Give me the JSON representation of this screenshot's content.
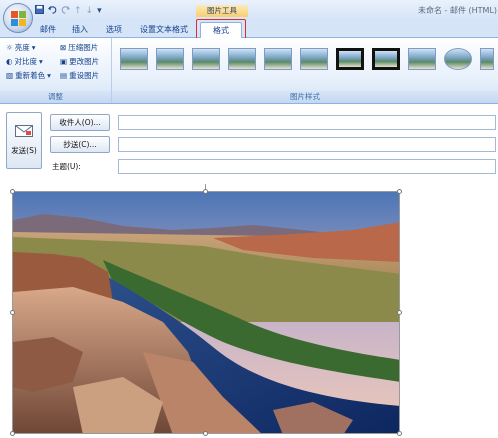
{
  "window": {
    "context_tool_title": "图片工具",
    "doc_title": "未命名 - 邮件 (HTML)"
  },
  "quick_access": {
    "save_icon": "save-icon",
    "undo_icon": "undo-icon",
    "redo_icon": "redo-icon",
    "customize_label": "▾"
  },
  "tabs": [
    {
      "label": "邮件"
    },
    {
      "label": "插入"
    },
    {
      "label": "选项"
    },
    {
      "label": "设置文本格式"
    },
    {
      "label": "格式",
      "active": true
    }
  ],
  "ribbon": {
    "adjust": {
      "label": "调整",
      "brightness": "亮度",
      "contrast": "对比度",
      "recolor": "重新着色",
      "compress": "压缩图片",
      "change": "更改图片",
      "reset": "重设图片"
    },
    "styles": {
      "label": "图片样式"
    }
  },
  "form": {
    "send_label": "发送(S)",
    "to_label": "收件人(O)...",
    "cc_label": "抄送(C)...",
    "subject_label": "主题(U):",
    "to_value": "",
    "cc_value": "",
    "subject_value": ""
  },
  "colors": {
    "ribbon_bg": "#d5e4f7",
    "accent": "#15428b",
    "highlight": "#e22a2a"
  }
}
